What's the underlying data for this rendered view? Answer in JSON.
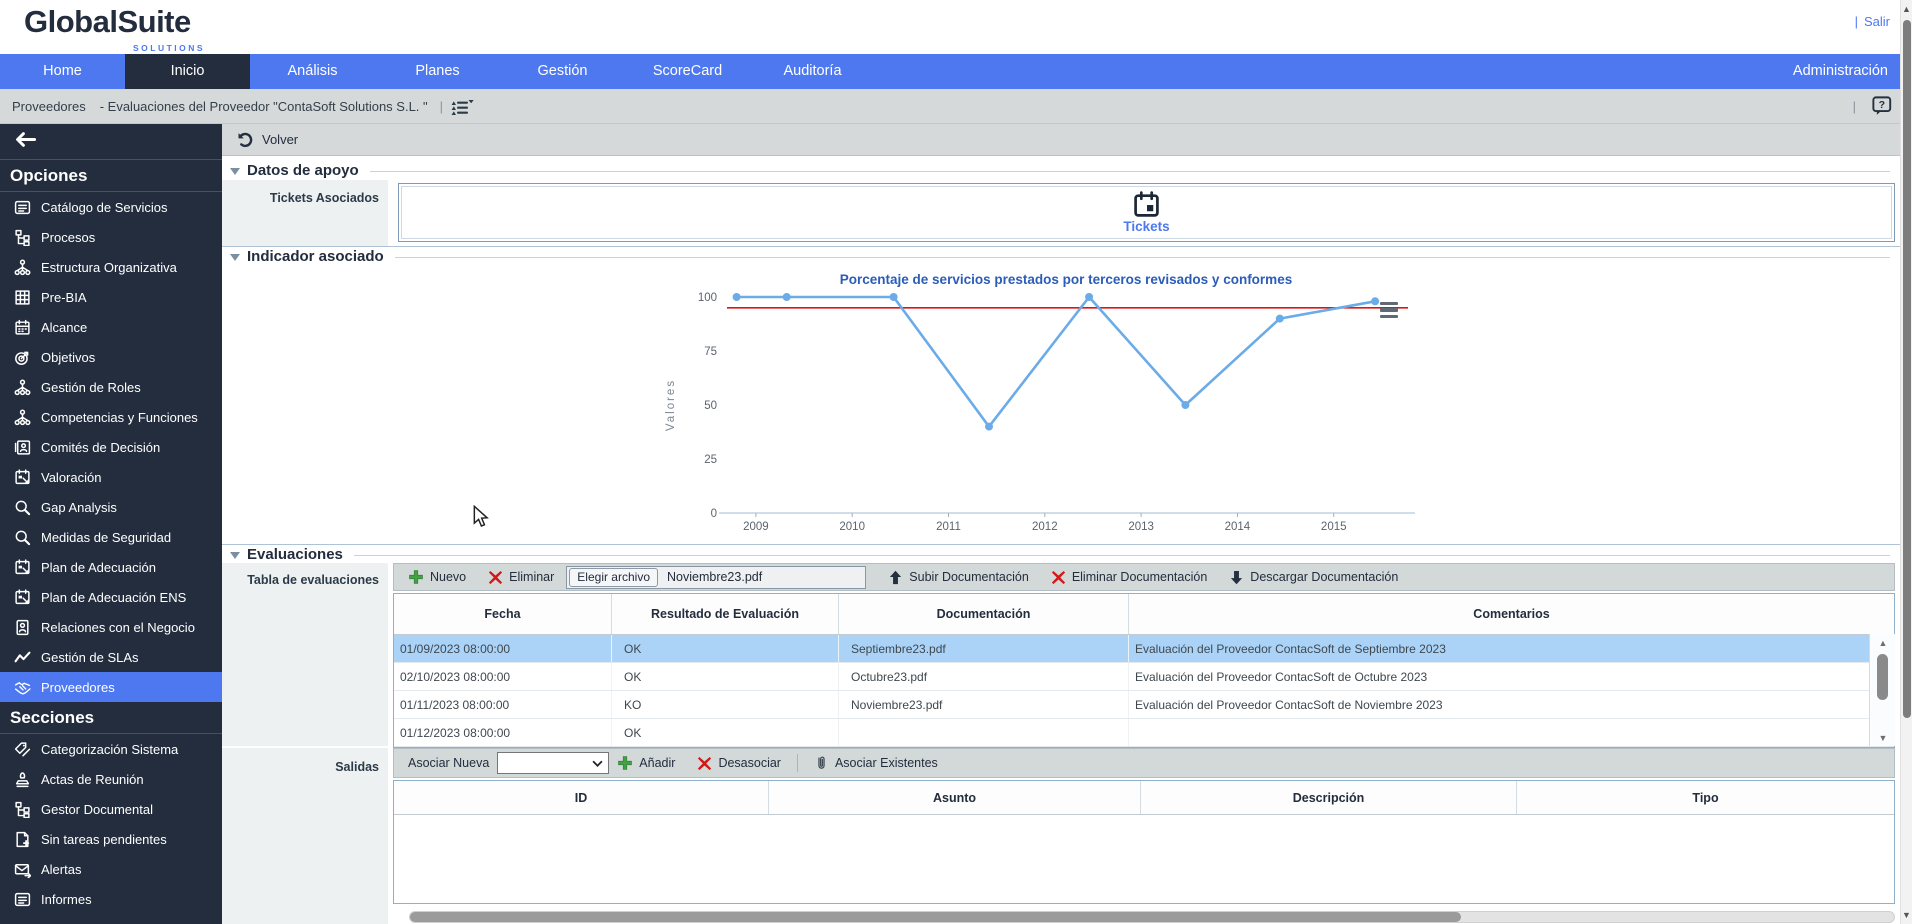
{
  "header": {
    "logo_main": "GlobalSuite",
    "logo_sub": "SOLUTIONS",
    "separator": "|",
    "logout_label": "Salir"
  },
  "nav": {
    "tabs": [
      {
        "label": "Home",
        "active": false
      },
      {
        "label": "Inicio",
        "active": true
      },
      {
        "label": "Análisis",
        "active": false
      },
      {
        "label": "Planes",
        "active": false
      },
      {
        "label": "Gestión",
        "active": false
      },
      {
        "label": "ScoreCard",
        "active": false
      },
      {
        "label": "Auditoría",
        "active": false
      }
    ],
    "right_tab": {
      "label": "Administración"
    }
  },
  "breadcrumb": {
    "section": "Proveedores",
    "detail": "- Evaluaciones del Proveedor \"ContaSoft Solutions S.L. \"",
    "separator": "|",
    "list_icon": "list-icon",
    "help_icon": "help-icon"
  },
  "sidebar": {
    "back_icon": "back-arrow-icon",
    "groups": [
      {
        "title": "Opciones",
        "items": [
          {
            "label": "Catálogo de Servicios",
            "icon": "catalog-folder-icon",
            "selected": false
          },
          {
            "label": "Procesos",
            "icon": "org-tree-icon",
            "selected": false
          },
          {
            "label": "Estructura Organizativa",
            "icon": "hierarchy-icon",
            "selected": false
          },
          {
            "label": "Pre-BIA",
            "icon": "grid-icon",
            "selected": false
          },
          {
            "label": "Alcance",
            "icon": "calendar-icon",
            "selected": false
          },
          {
            "label": "Objetivos",
            "icon": "target-icon",
            "selected": false
          },
          {
            "label": "Gestión de Roles",
            "icon": "hierarchy-icon",
            "selected": false
          },
          {
            "label": "Competencias y Funciones",
            "icon": "hierarchy-icon",
            "selected": false
          },
          {
            "label": "Comités de Decisión",
            "icon": "id-card-icon",
            "selected": false
          },
          {
            "label": "Valoración",
            "icon": "calendar-select-icon",
            "selected": false
          },
          {
            "label": "Gap Analysis",
            "icon": "search-icon",
            "selected": false
          },
          {
            "label": "Medidas de Seguridad",
            "icon": "search-icon",
            "selected": false
          },
          {
            "label": "Plan de Adecuación",
            "icon": "calendar-select-icon",
            "selected": false
          },
          {
            "label": "Plan de Adecuación ENS",
            "icon": "calendar-select-icon",
            "selected": false
          },
          {
            "label": "Relaciones con el Negocio",
            "icon": "person-badge-icon",
            "selected": false
          },
          {
            "label": "Gestión de SLAs",
            "icon": "line-chart-icon",
            "selected": false
          },
          {
            "label": "Proveedores",
            "icon": "handshake-icon",
            "selected": true
          }
        ]
      },
      {
        "title": "Secciones",
        "items": [
          {
            "label": "Categorización Sistema",
            "icon": "tags-icon",
            "selected": false
          },
          {
            "label": "Actas de Reunión",
            "icon": "stamp-icon",
            "selected": false
          },
          {
            "label": "Gestor Documental",
            "icon": "org-tree-icon",
            "selected": false
          },
          {
            "label": "Sin tareas pendientes",
            "icon": "doc-plus-icon",
            "selected": false
          },
          {
            "label": "Alertas",
            "icon": "mail-out-icon",
            "selected": false
          },
          {
            "label": "Informes",
            "icon": "catalog-folder-icon",
            "selected": false
          }
        ]
      }
    ]
  },
  "main": {
    "volver": {
      "label": "Volver",
      "icon": "undo-icon"
    },
    "sections": {
      "datos": "Datos de apoyo",
      "indicador": "Indicador asociado",
      "evaluaciones": "Evaluaciones"
    },
    "tickets": {
      "label": "Tickets Asociados",
      "button_label": "Tickets",
      "icon": "tickets-calendar-icon"
    },
    "evaluations": {
      "row_label": "Tabla de evaluaciones",
      "toolbar": {
        "nuevo": {
          "label": "Nuevo",
          "icon": "plus-icon"
        },
        "eliminar": {
          "label": "Eliminar",
          "icon": "red-x-icon"
        },
        "file": {
          "button_label": "Elegir archivo",
          "filename": "Noviembre23.pdf"
        },
        "subir": {
          "label": "Subir Documentación",
          "icon": "up-arrow-icon"
        },
        "eliminar_doc": {
          "label": "Eliminar Documentación",
          "icon": "red-x-icon"
        },
        "descargar": {
          "label": "Descargar Documentación",
          "icon": "down-arrow-icon"
        }
      },
      "columns": [
        "Fecha",
        "Resultado de Evaluación",
        "Documentación",
        "Comentarios"
      ],
      "rows": [
        {
          "fecha": "01/09/2023 08:00:00",
          "resultado": "OK",
          "documentacion": "Septiembre23.pdf",
          "comentarios": "Evaluación del Proveedor ContacSoft de Septiembre 2023",
          "selected": true
        },
        {
          "fecha": "02/10/2023 08:00:00",
          "resultado": "OK",
          "documentacion": "Octubre23.pdf",
          "comentarios": "Evaluación del Proveedor ContacSoft de Octubre 2023",
          "selected": false
        },
        {
          "fecha": "01/11/2023 08:00:00",
          "resultado": "KO",
          "documentacion": "Noviembre23.pdf",
          "comentarios": "Evaluación del Proveedor ContacSoft de Noviembre 2023",
          "selected": false
        },
        {
          "fecha": "01/12/2023 08:00:00",
          "resultado": "OK",
          "documentacion": "",
          "comentarios": "",
          "selected": false
        }
      ]
    },
    "salidas": {
      "row_label": "Salidas",
      "toolbar": {
        "asociar_nueva_label": "Asociar Nueva",
        "select_value": "",
        "select_icon": "chevron-down-icon",
        "anadir": {
          "label": "Añadir",
          "icon": "plus-icon"
        },
        "desasociar": {
          "label": "Desasociar",
          "icon": "red-x-icon"
        },
        "asociar_existentes": {
          "label": "Asociar Existentes",
          "icon": "paperclip-icon"
        }
      },
      "columns": [
        "ID",
        "Asunto",
        "Descripción",
        "Tipo"
      ],
      "rows": []
    }
  },
  "chart_data": {
    "type": "line",
    "title": "Porcentaje de servicios prestados por terceros revisados y conformes",
    "xlabel": "",
    "ylabel": "Valores",
    "x": [
      2008.8,
      2009.32,
      2010.43,
      2011.42,
      2012.46,
      2013.46,
      2014.44,
      2015.43
    ],
    "y": [
      100,
      100,
      100,
      40,
      100,
      50,
      90,
      98
    ],
    "xticks": [
      2009,
      2010,
      2011,
      2012,
      2013,
      2014,
      2015
    ],
    "yticks": [
      0,
      25,
      50,
      75,
      100
    ],
    "xlim": [
      2008.7,
      2015.74
    ],
    "ylim": [
      0,
      100
    ],
    "threshold": {
      "value": 95,
      "color": "#e01414"
    },
    "line_color": "#6aabe8",
    "grid": false,
    "legend": null
  },
  "colors": {
    "nav_blue": "#4d78f0",
    "dark_navy": "#232d3d",
    "selected_row": "#abd3f7",
    "chart_line": "#6aabe8",
    "threshold_red": "#e01414",
    "link_blue": "#4d78f0"
  }
}
